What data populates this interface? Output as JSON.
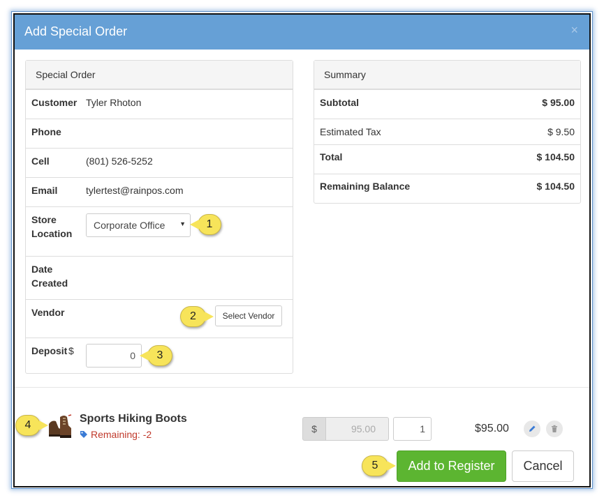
{
  "modal": {
    "title": "Add Special Order",
    "close_glyph": "×"
  },
  "special_order": {
    "heading": "Special Order",
    "customer_label": "Customer",
    "customer_value": "Tyler Rhoton",
    "phone_label": "Phone",
    "phone_value": "",
    "cell_label": "Cell",
    "cell_value": "(801) 526-5252",
    "email_label": "Email",
    "email_value": "tylertest@rainpos.com",
    "store_label_1": "Store",
    "store_label_2": "Location",
    "store_selected": "Corporate Office",
    "date_label_1": "Date",
    "date_label_2": "Created",
    "vendor_label": "Vendor",
    "vendor_button": "Select Vendor",
    "deposit_label": "Deposit",
    "deposit_currency": "$",
    "deposit_value": "0"
  },
  "summary": {
    "heading": "Summary",
    "subtotal_label": "Subtotal",
    "subtotal_value": "$ 95.00",
    "tax_label": "Estimated Tax",
    "tax_value": "$ 9.50",
    "total_label": "Total",
    "total_value": "$ 104.50",
    "balance_label": "Remaining Balance",
    "balance_value": "$ 104.50"
  },
  "item": {
    "name": "Sports Hiking Boots",
    "remaining": "Remaining: -2",
    "price_addon": "$",
    "price_value": "95.00",
    "quantity": "1",
    "line_total": "$95.00"
  },
  "footer": {
    "add_button": "Add to Register",
    "cancel_button": "Cancel"
  },
  "callouts": [
    "1",
    "2",
    "3",
    "4",
    "5"
  ],
  "colors": {
    "header": "#66a0d6",
    "primary_green": "#5cb531",
    "callout": "#f7e45a",
    "warning_text": "#c0392b",
    "tag_icon": "#3a7bd5"
  },
  "icons": {
    "edit": "pencil-icon",
    "delete": "trash-icon",
    "tag": "tag-icon",
    "caret": "caret-down-icon",
    "close": "close-icon"
  }
}
